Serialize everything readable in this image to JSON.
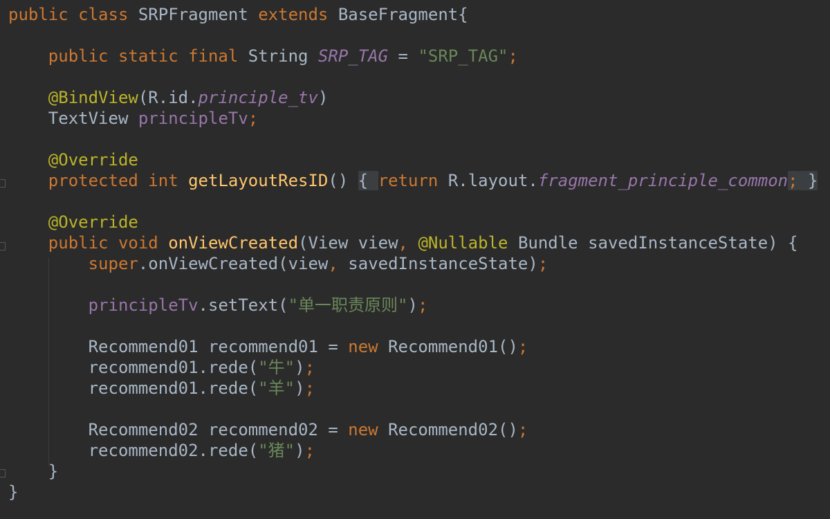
{
  "editor": {
    "lines": [
      {
        "tokens": [
          {
            "t": "public class ",
            "c": "kw"
          },
          {
            "t": "SRPFragment ",
            "c": ""
          },
          {
            "t": "extends ",
            "c": "kw"
          },
          {
            "t": "BaseFragment{",
            "c": ""
          }
        ]
      },
      {
        "tokens": []
      },
      {
        "tokens": [
          {
            "t": "    ",
            "c": ""
          },
          {
            "t": "public static final ",
            "c": "kw"
          },
          {
            "t": "String ",
            "c": ""
          },
          {
            "t": "SRP_TAG",
            "c": "fld it"
          },
          {
            "t": " = ",
            "c": ""
          },
          {
            "t": "\"SRP_TAG\"",
            "c": "str"
          },
          {
            "t": ";",
            "c": "kw"
          }
        ]
      },
      {
        "tokens": []
      },
      {
        "tokens": [
          {
            "t": "    ",
            "c": ""
          },
          {
            "t": "@BindView",
            "c": "ann"
          },
          {
            "t": "(R.id.",
            "c": ""
          },
          {
            "t": "principle_tv",
            "c": "fld it"
          },
          {
            "t": ")",
            "c": ""
          }
        ]
      },
      {
        "tokens": [
          {
            "t": "    ",
            "c": ""
          },
          {
            "t": "TextView ",
            "c": ""
          },
          {
            "t": "principleTv",
            "c": "fld"
          },
          {
            "t": ";",
            "c": "kw"
          }
        ]
      },
      {
        "tokens": []
      },
      {
        "tokens": [
          {
            "t": "    ",
            "c": ""
          },
          {
            "t": "@Override",
            "c": "ann"
          }
        ]
      },
      {
        "tokens": [
          {
            "t": "    ",
            "c": ""
          },
          {
            "t": "protected int ",
            "c": "kw"
          },
          {
            "t": "getLayoutResID",
            "c": "fn"
          },
          {
            "t": "() ",
            "c": ""
          },
          {
            "t": "{ ",
            "c": "fold-box"
          },
          {
            "t": "return ",
            "c": "kw"
          },
          {
            "t": "R.layout.",
            "c": ""
          },
          {
            "t": "fragment_principle_common",
            "c": "fld it"
          },
          {
            "t": ";",
            "c": "kw fold-box"
          },
          {
            "t": " }",
            "c": "fold-box"
          }
        ]
      },
      {
        "tokens": []
      },
      {
        "tokens": [
          {
            "t": "    ",
            "c": ""
          },
          {
            "t": "@Override",
            "c": "ann"
          }
        ]
      },
      {
        "tokens": [
          {
            "t": "    ",
            "c": ""
          },
          {
            "t": "public void ",
            "c": "kw"
          },
          {
            "t": "onViewCreated",
            "c": "fn"
          },
          {
            "t": "(View view",
            "c": ""
          },
          {
            "t": ", ",
            "c": "kw"
          },
          {
            "t": "@Nullable ",
            "c": "ann"
          },
          {
            "t": "Bundle savedInstanceState) {",
            "c": ""
          }
        ]
      },
      {
        "tokens": [
          {
            "t": "        ",
            "c": ""
          },
          {
            "t": "super",
            "c": "kw"
          },
          {
            "t": ".onViewCreated(view",
            "c": ""
          },
          {
            "t": ", ",
            "c": "kw"
          },
          {
            "t": "savedInstanceState)",
            "c": ""
          },
          {
            "t": ";",
            "c": "kw"
          }
        ]
      },
      {
        "tokens": []
      },
      {
        "tokens": [
          {
            "t": "        ",
            "c": ""
          },
          {
            "t": "principleTv",
            "c": "fld"
          },
          {
            "t": ".setText(",
            "c": ""
          },
          {
            "t": "\"单一职责原则\"",
            "c": "str"
          },
          {
            "t": ")",
            "c": ""
          },
          {
            "t": ";",
            "c": "kw"
          }
        ]
      },
      {
        "tokens": []
      },
      {
        "tokens": [
          {
            "t": "        ",
            "c": ""
          },
          {
            "t": "Recommend01 recommend01 = ",
            "c": ""
          },
          {
            "t": "new ",
            "c": "kw"
          },
          {
            "t": "Recommend01()",
            "c": ""
          },
          {
            "t": ";",
            "c": "kw"
          }
        ]
      },
      {
        "tokens": [
          {
            "t": "        ",
            "c": ""
          },
          {
            "t": "recommend01.rede(",
            "c": ""
          },
          {
            "t": "\"牛\"",
            "c": "str"
          },
          {
            "t": ")",
            "c": ""
          },
          {
            "t": ";",
            "c": "kw"
          }
        ]
      },
      {
        "tokens": [
          {
            "t": "        ",
            "c": ""
          },
          {
            "t": "recommend01.rede(",
            "c": ""
          },
          {
            "t": "\"羊\"",
            "c": "str"
          },
          {
            "t": ")",
            "c": ""
          },
          {
            "t": ";",
            "c": "kw"
          }
        ]
      },
      {
        "tokens": []
      },
      {
        "tokens": [
          {
            "t": "        ",
            "c": ""
          },
          {
            "t": "Recommend02 recommend02 = ",
            "c": ""
          },
          {
            "t": "new ",
            "c": "kw"
          },
          {
            "t": "Recommend02()",
            "c": ""
          },
          {
            "t": ";",
            "c": "kw"
          }
        ]
      },
      {
        "tokens": [
          {
            "t": "        ",
            "c": ""
          },
          {
            "t": "recommend02.rede(",
            "c": ""
          },
          {
            "t": "\"猪\"",
            "c": "str"
          },
          {
            "t": ")",
            "c": ""
          },
          {
            "t": ";",
            "c": "kw"
          }
        ]
      },
      {
        "tokens": [
          {
            "t": "    ",
            "c": ""
          },
          {
            "t": "}",
            "c": ""
          }
        ]
      },
      {
        "tokens": [
          {
            "t": "}",
            "c": ""
          }
        ]
      }
    ]
  },
  "colors": {
    "background": "#2b2b2b",
    "text": "#a9b7c6",
    "keyword": "#cc7832",
    "string": "#6a8759",
    "annotation": "#bbb529",
    "field": "#9876aa",
    "method": "#ffc66d",
    "fold_region": "#3c3f41"
  }
}
